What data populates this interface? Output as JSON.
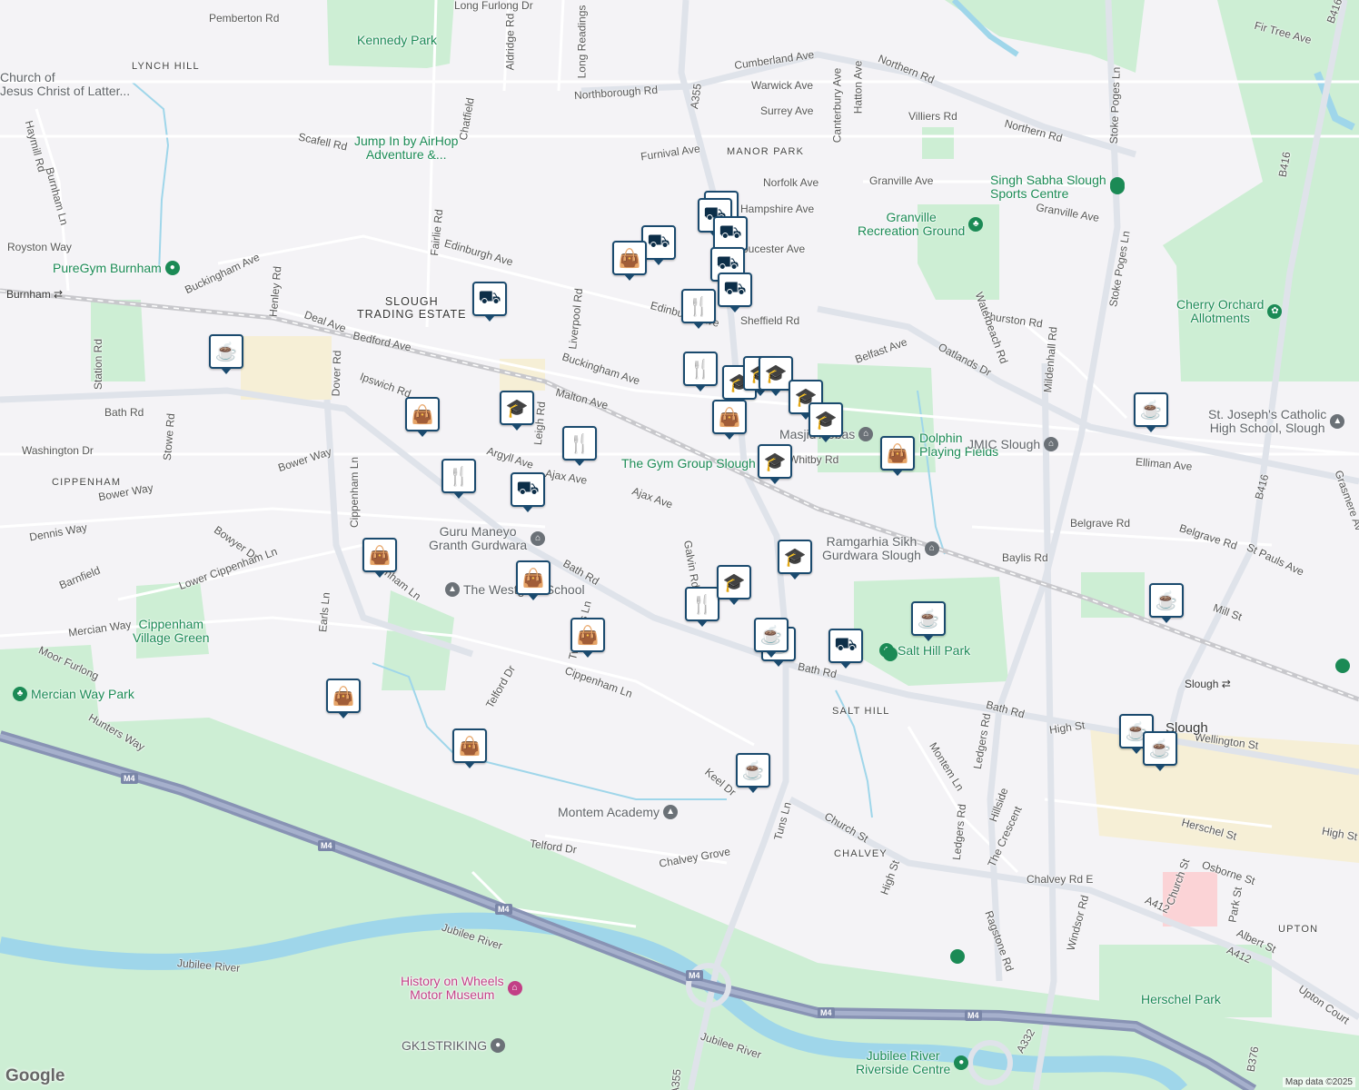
{
  "map": {
    "credit": "Map data ©2025",
    "logo": "Google",
    "road_labels": [
      "Pemberton Rd",
      "Long Furlong Dr",
      "Long Readings",
      "Aldridge Rd",
      "Cumberland Ave",
      "Northern Rd",
      "Fir Tree Ave",
      "B416",
      "Northborough Rd",
      "Warwick Ave",
      "Surrey Ave",
      "Canterbury Ave",
      "Hatton Ave",
      "Villiers Rd",
      "Northern Rd",
      "Stoke Poges Ln",
      "Scafell Rd",
      "Chatfield",
      "Furnival Ave",
      "Haymill Rd",
      "Burnham Ln",
      "Norfolk Ave",
      "Granville Ave",
      "Granville Ave",
      "B416",
      "Hampshire Ave",
      "Fairlie Rd",
      "Edinburgh Ave",
      "Royston Way",
      "Gloucester Ave",
      "Stoke Poges Ln",
      "Buckingham Ave",
      "Henley Rd",
      "Liverpool Rd",
      "Edinburgh Ave",
      "Sheffield Rd",
      "Thurston Rd",
      "Waterbeach Rd",
      "Deal Ave",
      "Bedford Ave",
      "Station Rd",
      "Bath Rd",
      "Belfast Ave",
      "Oatlands Dr",
      "Mildenhall Rd",
      "Buckingham Ave",
      "Ipswich Rd",
      "Malton Ave",
      "Dover Rd",
      "Leigh Rd",
      "Stowe Rd",
      "Washington Dr",
      "Argyll Ave",
      "Ajax Ave",
      "Whitby Rd",
      "Elliman Ave",
      "Bower Way",
      "Bower Way",
      "Cippenham Ln",
      "B416",
      "Ajax Ave",
      "Grasmere Av",
      "Belgrave Rd",
      "Belgrave Rd",
      "Bowyer Dr",
      "Dennis Way",
      "Bath Rd",
      "Cippenham Ln",
      "Galvin Rd",
      "Baylis Rd",
      "St Pauls Ave",
      "Barnfield",
      "Lower Cippenham Ln",
      "Earls Ln",
      "Mill St",
      "Mercian Way",
      "Twinches Ln",
      "Bath Rd",
      "Moor Furlong",
      "Cippenham Ln",
      "Telford Dr",
      "Bath Rd",
      "High St",
      "Wellington St",
      "Hunters Way",
      "Montem Ln",
      "Ledgers Rd",
      "Hillside",
      "Keel Dr",
      "Tuns Ln",
      "Church St",
      "Ledgers Rd",
      "The Crescent",
      "Herschel St",
      "High St",
      "Telford Dr",
      "Chalvey Grove",
      "High St",
      "Chalvey Rd E",
      "Church St",
      "Osborne St",
      "A412",
      "Park St",
      "Ragstone Rd",
      "Windsor Rd",
      "Albert St",
      "A412",
      "Upton Court",
      "A332",
      "B376",
      "Jubilee River",
      "Jubilee River",
      "Jubilee River",
      "A355",
      "A355"
    ],
    "area_labels": [
      "LYNCH HILL",
      "MANOR PARK",
      "CIPPENHAM",
      "SALT HILL",
      "CHALVEY",
      "UPTON"
    ],
    "district_label": "SLOUGH\nTRADING ESTATE",
    "places": [
      {
        "name": "Kennedy Park",
        "kind": "park"
      },
      {
        "name": "Jump In by AirHop\nAdventure &...",
        "kind": "attraction"
      },
      {
        "name": "Singh Sabha Slough\nSports Centre",
        "kind": "sport"
      },
      {
        "name": "Granville\nRecreation Ground",
        "kind": "park"
      },
      {
        "name": "PureGym Burnham",
        "kind": "sport"
      },
      {
        "name": "Burnham",
        "kind": "station"
      },
      {
        "name": "Cherry Orchard\nAllotments",
        "kind": "park"
      },
      {
        "name": "St. Joseph's Catholic\nHigh School, Slough",
        "kind": "school"
      },
      {
        "name": "Masjid Abbas",
        "kind": "worship"
      },
      {
        "name": "Dolphin\nPlaying Fields",
        "kind": "park"
      },
      {
        "name": "JMIC Slough",
        "kind": "worship"
      },
      {
        "name": "The Gym Group Slough",
        "kind": "sport"
      },
      {
        "name": "Guru Maneyo\nGranth Gurdwara",
        "kind": "worship"
      },
      {
        "name": "Ramgarhia Sikh\nGurdwara Slough",
        "kind": "worship"
      },
      {
        "name": "The Westgate School",
        "kind": "school"
      },
      {
        "name": "Cippenham\nVillage Green",
        "kind": "park"
      },
      {
        "name": "Salt Hill Park",
        "kind": "park"
      },
      {
        "name": "Mercian Way Park",
        "kind": "park"
      },
      {
        "name": "Slough",
        "kind": "station"
      },
      {
        "name": "Montem Academy",
        "kind": "school"
      },
      {
        "name": "Herschel Park",
        "kind": "park"
      },
      {
        "name": "History on Wheels\nMotor Museum",
        "kind": "museum"
      },
      {
        "name": "GK1STRIKING",
        "kind": "business"
      },
      {
        "name": "Jubilee River\nRiverside Centre",
        "kind": "park"
      },
      {
        "name": "Slough",
        "kind": "town"
      },
      {
        "name": "Church of\nJesus Christ of Latter...",
        "kind": "worship"
      }
    ],
    "motorway": "M4",
    "markers": [
      {
        "type": "cafe"
      },
      {
        "type": "grocery"
      },
      {
        "type": "grocery"
      },
      {
        "type": "grocery"
      },
      {
        "type": "grocery"
      },
      {
        "type": "grocery"
      },
      {
        "type": "grocery"
      },
      {
        "type": "shopping"
      },
      {
        "type": "grocery"
      },
      {
        "type": "dining"
      },
      {
        "type": "dining"
      },
      {
        "type": "school"
      },
      {
        "type": "school"
      },
      {
        "type": "school"
      },
      {
        "type": "school"
      },
      {
        "type": "shopping"
      },
      {
        "type": "school"
      },
      {
        "type": "school"
      },
      {
        "type": "shopping"
      },
      {
        "type": "dining"
      },
      {
        "type": "dining"
      },
      {
        "type": "grocery"
      },
      {
        "type": "shopping"
      },
      {
        "type": "shopping"
      },
      {
        "type": "shopping"
      },
      {
        "type": "school"
      },
      {
        "type": "school"
      },
      {
        "type": "dining"
      },
      {
        "type": "cafe"
      },
      {
        "type": "cafe"
      },
      {
        "type": "grocery"
      },
      {
        "type": "cafe"
      },
      {
        "type": "cafe"
      },
      {
        "type": "cafe"
      },
      {
        "type": "cafe"
      },
      {
        "type": "shopping"
      },
      {
        "type": "shopping"
      },
      {
        "type": "cafe"
      },
      {
        "type": "cafe"
      },
      {
        "type": "shopping"
      },
      {
        "type": "cafe"
      }
    ]
  }
}
